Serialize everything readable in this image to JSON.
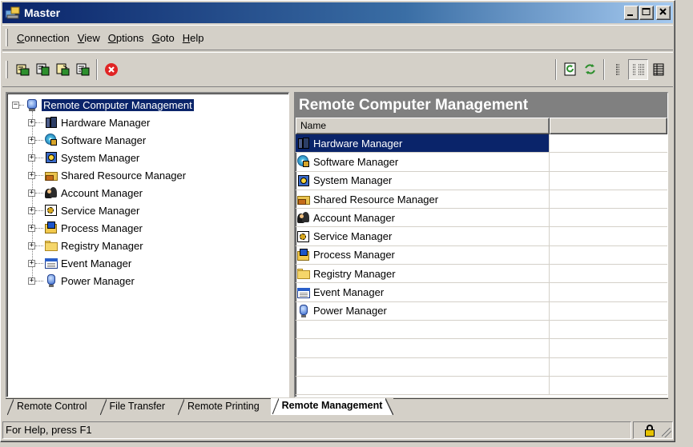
{
  "window": {
    "title": "Master",
    "controls": [
      "minimize",
      "maximize",
      "close"
    ]
  },
  "menu": {
    "items": [
      {
        "label": "Connection",
        "accel": "C",
        "rest": "onnection"
      },
      {
        "label": "View",
        "accel": "V",
        "rest": "iew"
      },
      {
        "label": "Options",
        "accel": "O",
        "rest": "ptions"
      },
      {
        "label": "Goto",
        "accel": "G",
        "rest": "oto"
      },
      {
        "label": "Help",
        "accel": "H",
        "rest": "elp"
      }
    ]
  },
  "toolbar": {
    "left_icons": [
      "connect-icon",
      "connect-all-icon",
      "disconnect-icon",
      "properties-icon",
      "stop-icon"
    ],
    "right_icons": [
      "refresh-icon",
      "sync-icon",
      "list-view-icon",
      "details-view-icon",
      "small-icons-view-icon"
    ],
    "pressed": "details-view-icon"
  },
  "tree": {
    "root_label": "Remote Computer Management",
    "items": [
      {
        "label": "Hardware Manager",
        "icon": "hardware-icon"
      },
      {
        "label": "Software Manager",
        "icon": "software-icon"
      },
      {
        "label": "System Manager",
        "icon": "system-icon"
      },
      {
        "label": "Shared Resource Manager",
        "icon": "shared-resource-icon"
      },
      {
        "label": "Account Manager",
        "icon": "account-icon"
      },
      {
        "label": "Service Manager",
        "icon": "service-icon"
      },
      {
        "label": "Process Manager",
        "icon": "process-icon"
      },
      {
        "label": "Registry Manager",
        "icon": "registry-icon"
      },
      {
        "label": "Event Manager",
        "icon": "event-icon"
      },
      {
        "label": "Power Manager",
        "icon": "power-icon"
      }
    ]
  },
  "list": {
    "title": "Remote Computer Management",
    "columns": [
      "Name",
      ""
    ],
    "selected_index": 0,
    "rows": [
      "Hardware Manager",
      "Software Manager",
      "System Manager",
      "Shared Resource Manager",
      "Account Manager",
      "Service Manager",
      "Process Manager",
      "Registry Manager",
      "Event Manager",
      "Power Manager"
    ]
  },
  "tabs": {
    "items": [
      "Remote Control",
      "File Transfer",
      "Remote Printing",
      "Remote Management"
    ],
    "active": "Remote Management"
  },
  "status": {
    "text": "For Help, press F1",
    "indicator_icon": "lock-icon"
  },
  "colors": {
    "title_gradient_start": "#0a246a",
    "selection": "#0a246a",
    "list_title_bg": "#808080",
    "face": "#d4d0c8"
  }
}
